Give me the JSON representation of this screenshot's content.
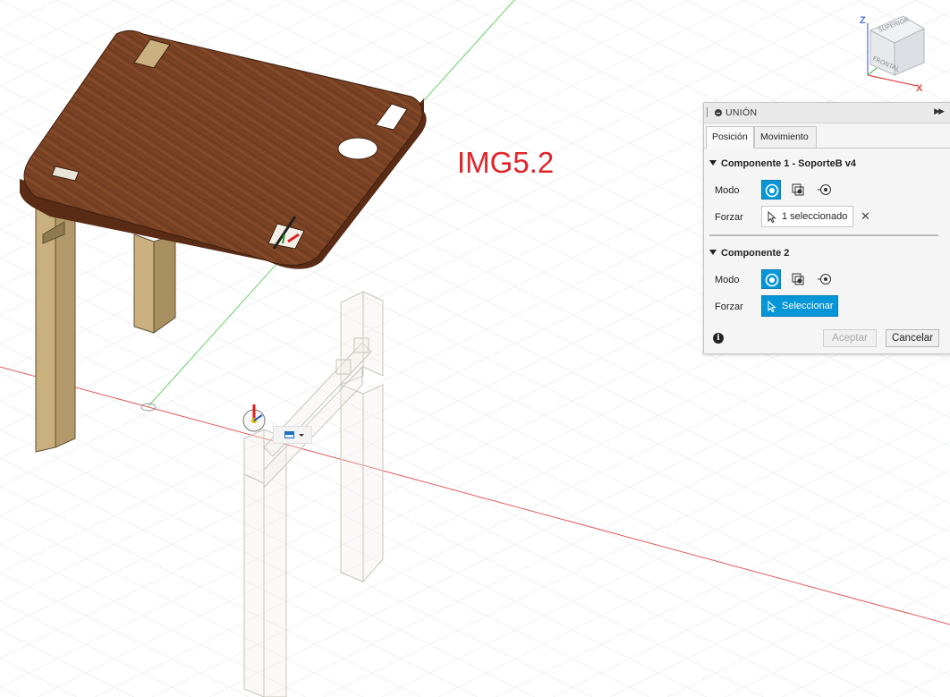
{
  "overlay_label": "IMG5.2",
  "viewcube": {
    "top_face": "SUPERIOR",
    "front_face": "FRONTAL",
    "axis_z": "Z",
    "axis_x": "X"
  },
  "joint_panel": {
    "title": "UNIÓN",
    "tabs": [
      {
        "label": "Posición",
        "active": true
      },
      {
        "label": "Movimiento",
        "active": false
      }
    ],
    "component1": {
      "title": "Componente 1 - SoporteB v4",
      "mode_label": "Modo",
      "snap_label": "Forzar",
      "snap_value": "1 seleccionado"
    },
    "component2": {
      "title": "Componente 2",
      "mode_label": "Modo",
      "snap_label": "Forzar",
      "snap_value": "Seleccionar"
    },
    "ok_label": "Aceptar",
    "cancel_label": "Cancelar",
    "mode_icons": [
      "simple-mode-icon",
      "between-two-faces-icon",
      "two-edge-intersection-icon"
    ]
  },
  "colors": {
    "accent_blue": "#0696d7",
    "label_red": "#e0242a",
    "wood_top": "#7a4124",
    "leg_wood": "#cdb485"
  }
}
